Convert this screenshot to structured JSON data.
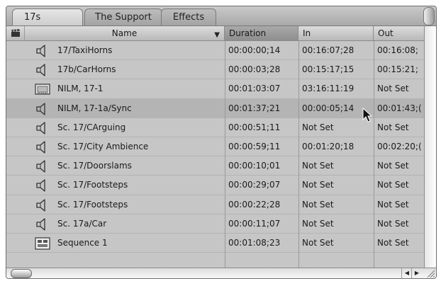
{
  "tabs": [
    {
      "label": "17s",
      "active": true
    },
    {
      "label": "The Support",
      "active": false
    },
    {
      "label": "Effects",
      "active": false
    }
  ],
  "columns": {
    "name": "Name",
    "duration": "Duration",
    "in": "In",
    "out": "Out"
  },
  "rows": [
    {
      "icon": "audio-clip-icon",
      "name": "17/TaxiHorns",
      "duration": "00:00:00;14",
      "in": "00:16:07;28",
      "out": "00:16:08;"
    },
    {
      "icon": "audio-clip-icon",
      "name": "17b/CarHorns",
      "duration": "00:00:03;28",
      "in": "00:15:17;15",
      "out": "00:15:21;"
    },
    {
      "icon": "video-clip-icon",
      "name": "NILM, 17-1",
      "duration": "00:01:03:07",
      "in": "03:16:11:19",
      "out": "Not Set"
    },
    {
      "icon": "audio-clip-icon",
      "name": "NILM, 17-1a/Sync",
      "duration": "00:01:37;21",
      "in": "00:00:05;14",
      "out": "00:01:43;("
    },
    {
      "icon": "audio-clip-icon",
      "name": "Sc. 17/CArguing",
      "duration": "00:00:51;11",
      "in": "Not Set",
      "out": "Not Set"
    },
    {
      "icon": "audio-clip-icon",
      "name": "Sc. 17/City Ambience",
      "duration": "00:00:59;11",
      "in": "00:01:20;18",
      "out": "00:02:20;("
    },
    {
      "icon": "audio-clip-icon",
      "name": "Sc. 17/Doorslams",
      "duration": "00:00:10;01",
      "in": "Not Set",
      "out": "Not Set"
    },
    {
      "icon": "audio-clip-icon",
      "name": "Sc. 17/Footsteps",
      "duration": "00:00:29;07",
      "in": "Not Set",
      "out": "Not Set"
    },
    {
      "icon": "audio-clip-icon",
      "name": "Sc. 17/Footsteps",
      "duration": "00:00:22;28",
      "in": "Not Set",
      "out": "Not Set"
    },
    {
      "icon": "audio-clip-icon",
      "name": "Sc. 17a/Car",
      "duration": "00:00:11;07",
      "in": "Not Set",
      "out": "Not Set"
    },
    {
      "icon": "sequence-icon",
      "name": "Sequence 1",
      "duration": "00:01:08;23",
      "in": "Not Set",
      "out": "Not Set"
    }
  ],
  "selected_row": 3,
  "colors": {
    "panel": "#c6c6c6",
    "selected_row": "#b4b4b4",
    "sorted_header": "#9a9a9a"
  }
}
